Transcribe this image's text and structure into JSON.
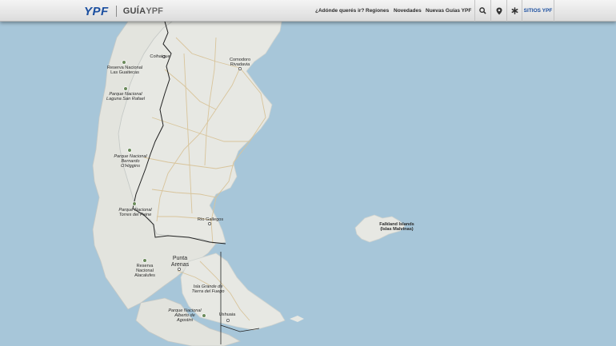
{
  "header": {
    "logo_ypf": "YPF",
    "logo_guia": "GUÍA",
    "logo_guia_ypf": "YPF",
    "nav": [
      {
        "label": "¿Adónde querés ir?"
      },
      {
        "label": "Regiones"
      },
      {
        "label": "Novedades"
      },
      {
        "label": "Nuevas Guías YPF"
      }
    ],
    "tools": [
      {
        "icon": "search-icon"
      },
      {
        "icon": "location-pin-icon"
      },
      {
        "icon": "asterisk-icon"
      }
    ],
    "sites_label": "SITIOS YPF"
  },
  "map": {
    "colors": {
      "sea": "#a7c6d9",
      "land": "#e6e7e2",
      "roads": "#d7c399",
      "border": "#222222"
    },
    "places": [
      {
        "name": "Coihaique"
      },
      {
        "name": "Comodoro\nRivadavia"
      },
      {
        "name": "Reserva Nacional\nLas Guaitecas"
      },
      {
        "name": "Parque Nacional\nLaguna San Rafael"
      },
      {
        "name": "Parque Nacional\nBernardo\nO'Higgins"
      },
      {
        "name": "Parque Nacional\nTorres del Paine"
      },
      {
        "name": "Río Gallegos"
      },
      {
        "name": "Falkland Islands\n(Islas Malvinas)"
      },
      {
        "name": "Punta\nArenas"
      },
      {
        "name": "Reserva\nNacional\nAlacalufes"
      },
      {
        "name": "Isla Grande de\nTierra del Fuego"
      },
      {
        "name": "Parque Nacional\nAlberto de\nAgostini"
      },
      {
        "name": "Ushuaia"
      }
    ]
  }
}
